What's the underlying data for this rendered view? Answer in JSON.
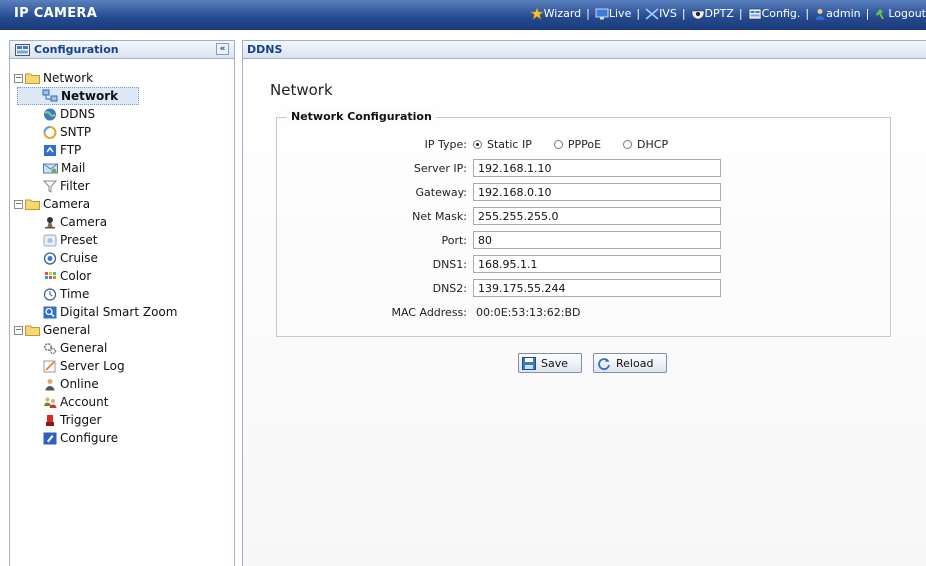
{
  "app": {
    "title": "IP CAMERA"
  },
  "topnav": [
    {
      "label": "Wizard",
      "icon": "wizard-icon"
    },
    {
      "label": "Live",
      "icon": "monitor-icon"
    },
    {
      "label": "IVS",
      "icon": "ivs-icon"
    },
    {
      "label": "DPTZ",
      "icon": "camera-dome-icon"
    },
    {
      "label": "Config.",
      "icon": "config-icon"
    },
    {
      "label": "admin",
      "icon": "user-icon"
    },
    {
      "label": "Logout",
      "icon": "logout-icon"
    }
  ],
  "sidebar": {
    "title": "Configuration",
    "collapse_label": "«",
    "tree": [
      {
        "label": "Network",
        "type": "folder",
        "expanded": true
      },
      {
        "label": "Network",
        "type": "leaf",
        "selected": true,
        "icon": "network-icon"
      },
      {
        "label": "DDNS",
        "type": "leaf",
        "icon": "ddns-icon"
      },
      {
        "label": "SNTP",
        "type": "leaf",
        "icon": "sntp-icon"
      },
      {
        "label": "FTP",
        "type": "leaf",
        "icon": "ftp-icon"
      },
      {
        "label": "Mail",
        "type": "leaf",
        "icon": "mail-icon"
      },
      {
        "label": "Filter",
        "type": "leaf",
        "icon": "filter-icon"
      },
      {
        "label": "Camera",
        "type": "folder",
        "expanded": true
      },
      {
        "label": "Camera",
        "type": "leaf",
        "icon": "camera-icon"
      },
      {
        "label": "Preset",
        "type": "leaf",
        "icon": "preset-icon"
      },
      {
        "label": "Cruise",
        "type": "leaf",
        "icon": "cruise-icon"
      },
      {
        "label": "Color",
        "type": "leaf",
        "icon": "color-icon"
      },
      {
        "label": "Time",
        "type": "leaf",
        "icon": "time-icon"
      },
      {
        "label": "Digital Smart Zoom",
        "type": "leaf",
        "icon": "zoom-icon"
      },
      {
        "label": "General",
        "type": "folder",
        "expanded": true
      },
      {
        "label": "General",
        "type": "leaf",
        "icon": "general-icon"
      },
      {
        "label": "Server Log",
        "type": "leaf",
        "icon": "log-icon"
      },
      {
        "label": "Online",
        "type": "leaf",
        "icon": "online-icon"
      },
      {
        "label": "Account",
        "type": "leaf",
        "icon": "account-icon"
      },
      {
        "label": "Trigger",
        "type": "leaf",
        "icon": "trigger-icon"
      },
      {
        "label": "Configure",
        "type": "leaf",
        "icon": "configure-icon"
      }
    ]
  },
  "main": {
    "header": "DDNS",
    "title": "Network",
    "section_title": "Network Configuration",
    "ip_type": {
      "label": "IP Type:",
      "options": [
        "Static IP",
        "PPPoE",
        "DHCP"
      ],
      "selected": "Static IP"
    },
    "fields": [
      {
        "label": "Server IP:",
        "value": "192.168.1.10"
      },
      {
        "label": "Gateway:",
        "value": "192.168.0.10"
      },
      {
        "label": "Net Mask:",
        "value": "255.255.255.0"
      },
      {
        "label": "Port:",
        "value": "80"
      },
      {
        "label": "DNS1:",
        "value": "168.95.1.1"
      },
      {
        "label": "DNS2:",
        "value": "139.175.55.244"
      }
    ],
    "mac": {
      "label": "MAC Address:",
      "value": "00:0E:53:13:62:BD"
    },
    "buttons": {
      "save": "Save",
      "reload": "Reload"
    }
  }
}
